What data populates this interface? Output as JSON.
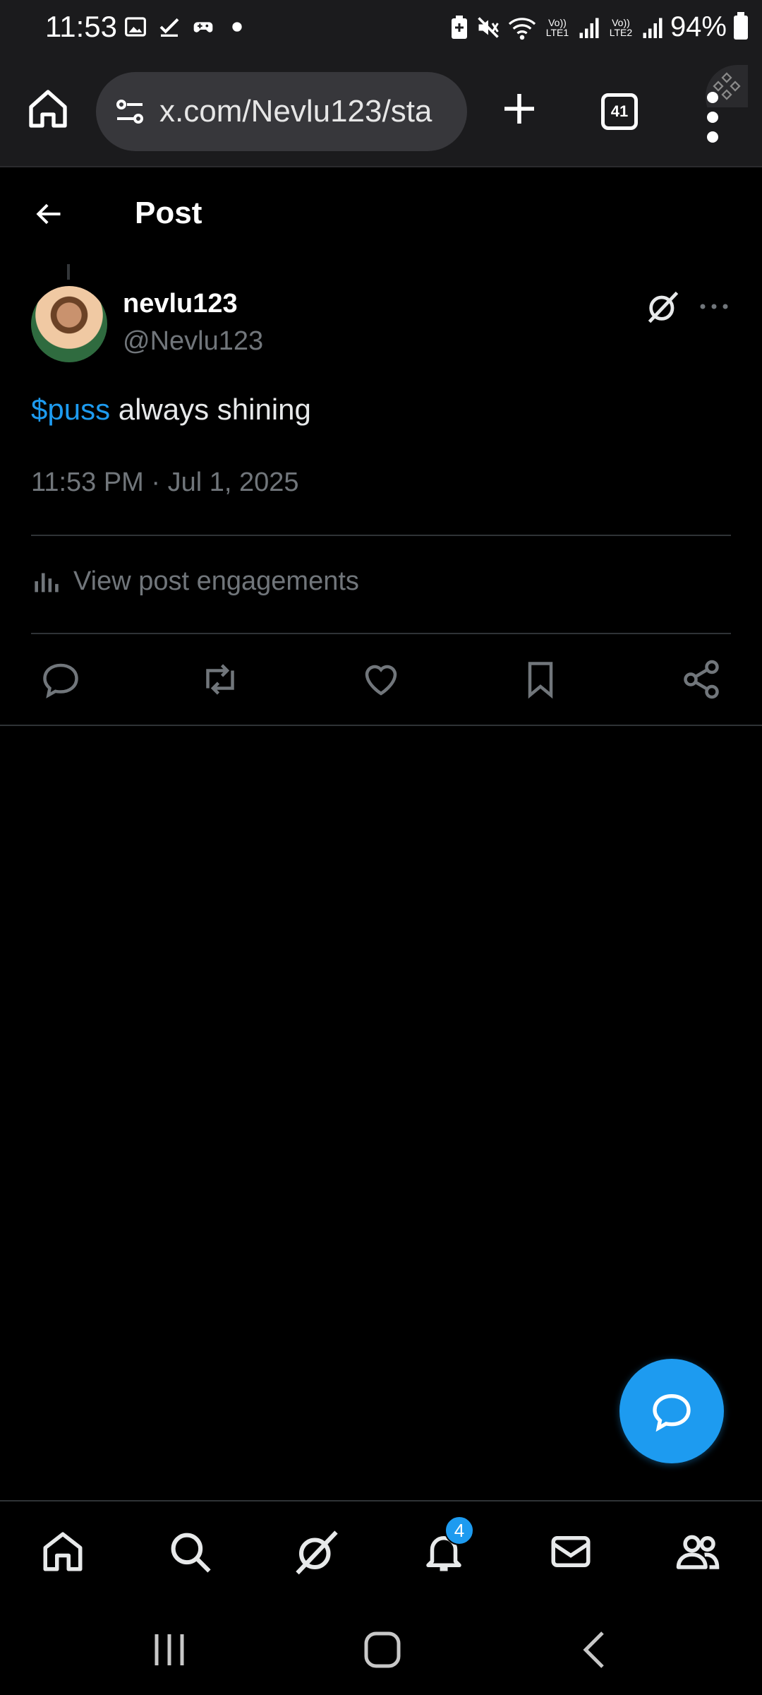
{
  "status_bar": {
    "time": "11:53",
    "signal_labels": [
      "Vo)) LTE1",
      "Vo)) LTE2"
    ],
    "battery": "94%"
  },
  "browser": {
    "url": "x.com/Nevlu123/sta",
    "tab_count": "41"
  },
  "header": {
    "title": "Post"
  },
  "post": {
    "author_name": "nevlu123",
    "author_handle": "@Nevlu123",
    "cashtag": "$puss",
    "text": " always shining",
    "timestamp": "11:53 PM · Jul 1, 2025",
    "engagements_label": "View post engagements"
  },
  "bottom_nav": {
    "notifications_badge": "4"
  },
  "colors": {
    "accent": "#1d9bf0",
    "background": "#000000",
    "muted_text": "#71767b",
    "divider": "#2f3336"
  },
  "icons": {
    "status_left": [
      "gallery-icon",
      "check-icon",
      "gamepad-icon",
      "dot-icon"
    ],
    "actions": [
      "reply-icon",
      "repost-icon",
      "like-icon",
      "bookmark-icon",
      "share-icon"
    ],
    "nav": [
      "home-icon",
      "search-icon",
      "grok-icon",
      "notifications-icon",
      "messages-icon",
      "communities-icon"
    ]
  }
}
